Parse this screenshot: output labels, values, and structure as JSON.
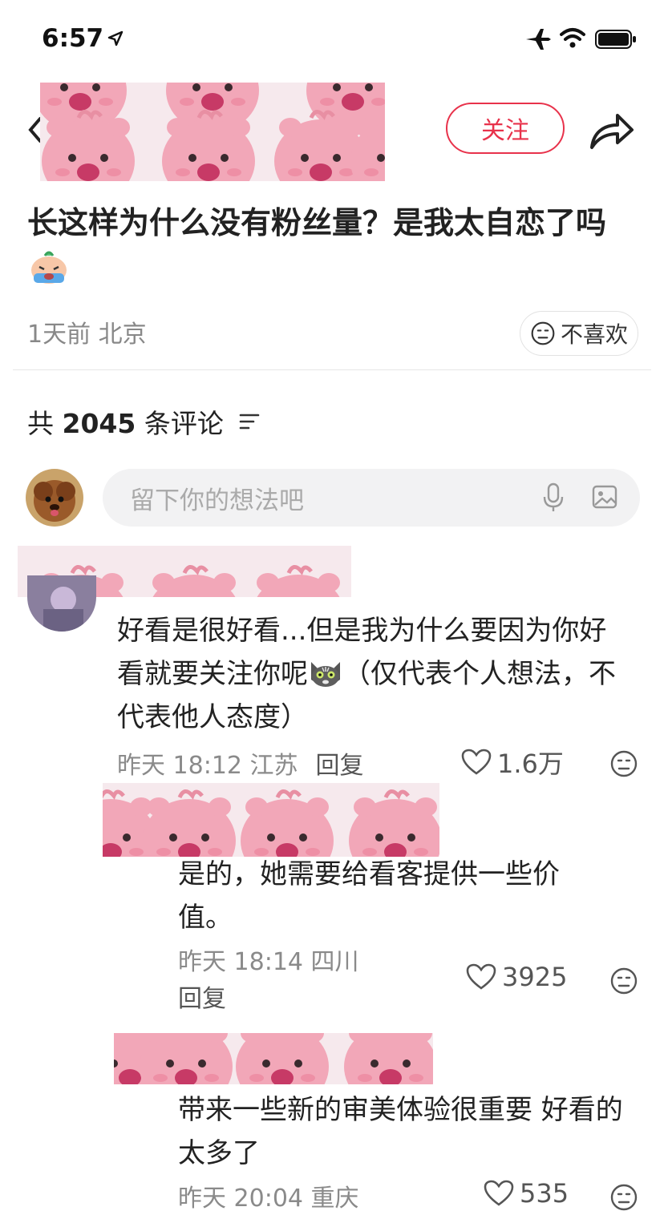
{
  "status_bar": {
    "time": "6:57"
  },
  "header": {
    "follow_label": "关注"
  },
  "post": {
    "title": "长这样为什么没有粉丝量？是我太自恋了吗",
    "meta": "1天前 北京",
    "dislike_label": "不喜欢"
  },
  "comments_section": {
    "count_prefix": "共",
    "count": "2045",
    "count_suffix": "条评论",
    "input_placeholder": "留下你的想法吧"
  },
  "comments": [
    {
      "text_a": "好看是很好看...但是我为什么要因为你好看就要关注你呢",
      "text_b": "（仅代表个人想法，不代表他人态度）",
      "meta": "昨天 18:12 江苏",
      "reply_label": "回复",
      "likes": "1.6万"
    },
    {
      "text": "是的，她需要给看客提供一些价值。",
      "meta": "昨天 18:14 四川",
      "reply_label": "回复",
      "likes": "3925"
    },
    {
      "text": "带来一些新的审美体验很重要 好看的太多了",
      "meta": "昨天 20:04 重庆",
      "likes": "535"
    }
  ],
  "colors": {
    "accent": "#e8324b",
    "cover_pink": "#f2a7b8",
    "input_bg": "#f2f2f3"
  },
  "icons": [
    "location-arrow-icon",
    "airplane-icon",
    "wifi-icon",
    "battery-icon",
    "back-icon",
    "share-icon",
    "meh-face-icon",
    "sort-icon",
    "microphone-icon",
    "image-icon",
    "heart-icon",
    "crying-face-emoji",
    "cat-face-emoji"
  ]
}
